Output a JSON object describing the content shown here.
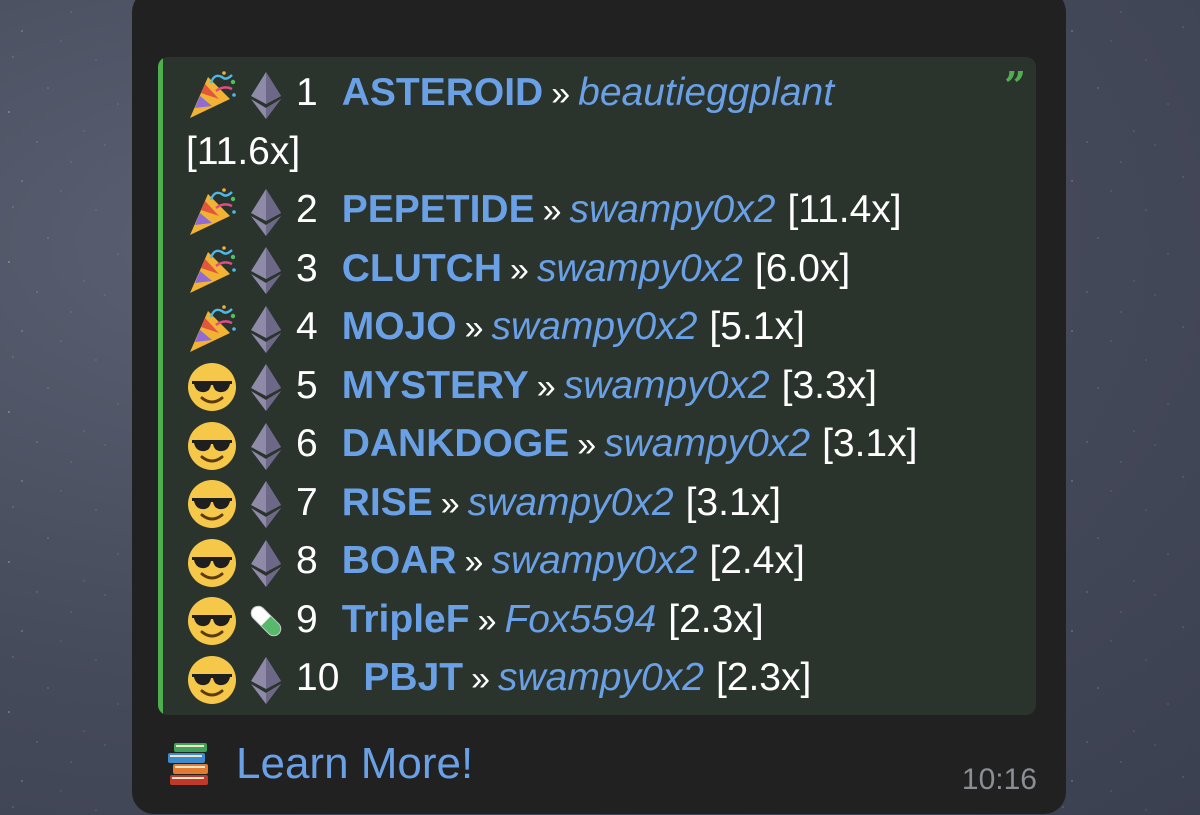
{
  "message": {
    "rows": [
      {
        "rank": "1",
        "token": "ASTEROID",
        "sep": "»",
        "user": "beautieggplant",
        "multiplier": "[11.6x]",
        "status_icon": "party-popper-icon",
        "chain_icon": "ethereum-icon"
      },
      {
        "rank": "2",
        "token": "PEPETIDE",
        "sep": "»",
        "user": "swampy0x2",
        "multiplier": "[11.4x]",
        "status_icon": "party-popper-icon",
        "chain_icon": "ethereum-icon"
      },
      {
        "rank": "3",
        "token": "CLUTCH",
        "sep": "»",
        "user": "swampy0x2",
        "multiplier": "[6.0x]",
        "status_icon": "party-popper-icon",
        "chain_icon": "ethereum-icon"
      },
      {
        "rank": "4",
        "token": "MOJO",
        "sep": "»",
        "user": "swampy0x2",
        "multiplier": "[5.1x]",
        "status_icon": "party-popper-icon",
        "chain_icon": "ethereum-icon"
      },
      {
        "rank": "5",
        "token": "MYSTERY",
        "sep": "»",
        "user": "swampy0x2",
        "multiplier": "[3.3x]",
        "status_icon": "sunglasses-face-icon",
        "chain_icon": "ethereum-icon"
      },
      {
        "rank": "6",
        "token": "DANKDOGE",
        "sep": "»",
        "user": "swampy0x2",
        "multiplier": "[3.1x]",
        "status_icon": "sunglasses-face-icon",
        "chain_icon": "ethereum-icon"
      },
      {
        "rank": "7",
        "token": "RISE",
        "sep": "»",
        "user": "swampy0x2",
        "multiplier": "[3.1x]",
        "status_icon": "sunglasses-face-icon",
        "chain_icon": "ethereum-icon"
      },
      {
        "rank": "8",
        "token": "BOAR",
        "sep": "»",
        "user": "swampy0x2",
        "multiplier": "[2.4x]",
        "status_icon": "sunglasses-face-icon",
        "chain_icon": "ethereum-icon"
      },
      {
        "rank": "9",
        "token": "TripleF",
        "sep": "»",
        "user": "Fox5594",
        "multiplier": "[2.3x]",
        "status_icon": "sunglasses-face-icon",
        "chain_icon": "pill-icon"
      },
      {
        "rank": "10",
        "token": "PBJT",
        "sep": "»",
        "user": "swampy0x2",
        "multiplier": "[2.3x]",
        "status_icon": "sunglasses-face-icon",
        "chain_icon": "ethereum-icon"
      }
    ],
    "footer": {
      "link_label": "Learn More!",
      "icon": "books-icon"
    },
    "time": "10:16"
  },
  "colors": {
    "bubble": "#212121",
    "quote_background": "#2a332c",
    "quote_accent": "#4fae4e",
    "link": "#6aa0e6",
    "text": "#ffffff",
    "timestamp": "#8a8f96"
  }
}
